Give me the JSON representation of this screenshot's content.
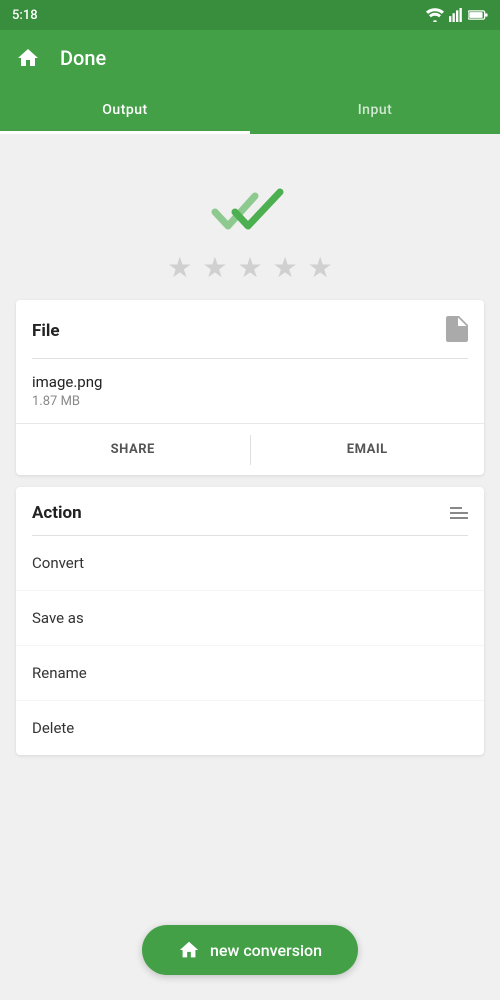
{
  "statusBar": {
    "time": "5:18"
  },
  "topBar": {
    "title": "Done",
    "homeIcon": "home"
  },
  "tabs": [
    {
      "label": "Output",
      "active": true
    },
    {
      "label": "Input",
      "active": false
    }
  ],
  "checkArea": {
    "stars": [
      "★",
      "★",
      "★",
      "★",
      "★"
    ]
  },
  "fileCard": {
    "title": "File",
    "fileName": "image.png",
    "fileSize": "1.87 MB",
    "shareLabel": "SHARE",
    "emailLabel": "EMAIL"
  },
  "actionCard": {
    "title": "Action",
    "items": [
      {
        "label": "Convert"
      },
      {
        "label": "Save as"
      },
      {
        "label": "Rename"
      },
      {
        "label": "Delete"
      }
    ]
  },
  "bottomButton": {
    "label": "new conversion"
  }
}
